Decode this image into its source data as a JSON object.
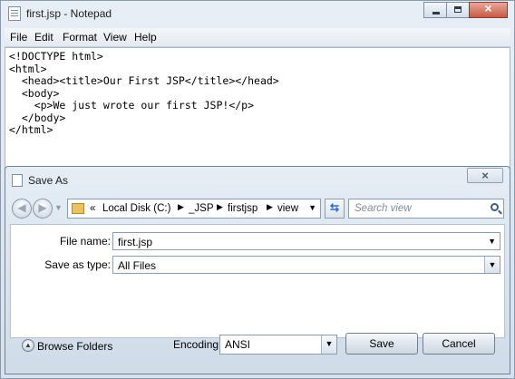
{
  "notepad": {
    "title": "first.jsp - Notepad",
    "menu": [
      "File",
      "Edit",
      "Format",
      "View",
      "Help"
    ],
    "lines": [
      "<!DOCTYPE html>",
      "<html>",
      "  <head><title>Our First JSP</title></head>",
      "  <body>",
      "    <p>We just wrote our first JSP!</p>",
      "  </body>",
      "</html>"
    ]
  },
  "dialog": {
    "title": "Save As",
    "address": {
      "overflow": "«",
      "crumbs": [
        "Local Disk (C:)",
        "_JSP",
        "firstjsp",
        "view"
      ]
    },
    "search_placeholder": "Search view",
    "file_name_label": "File name:",
    "file_name_value": "first.jsp",
    "save_type_label": "Save as type:",
    "save_type_value": "All Files",
    "browse_folders": "Browse Folders",
    "encoding_label": "Encoding:",
    "encoding_value": "ANSI",
    "save_button": "Save",
    "cancel_button": "Cancel"
  }
}
